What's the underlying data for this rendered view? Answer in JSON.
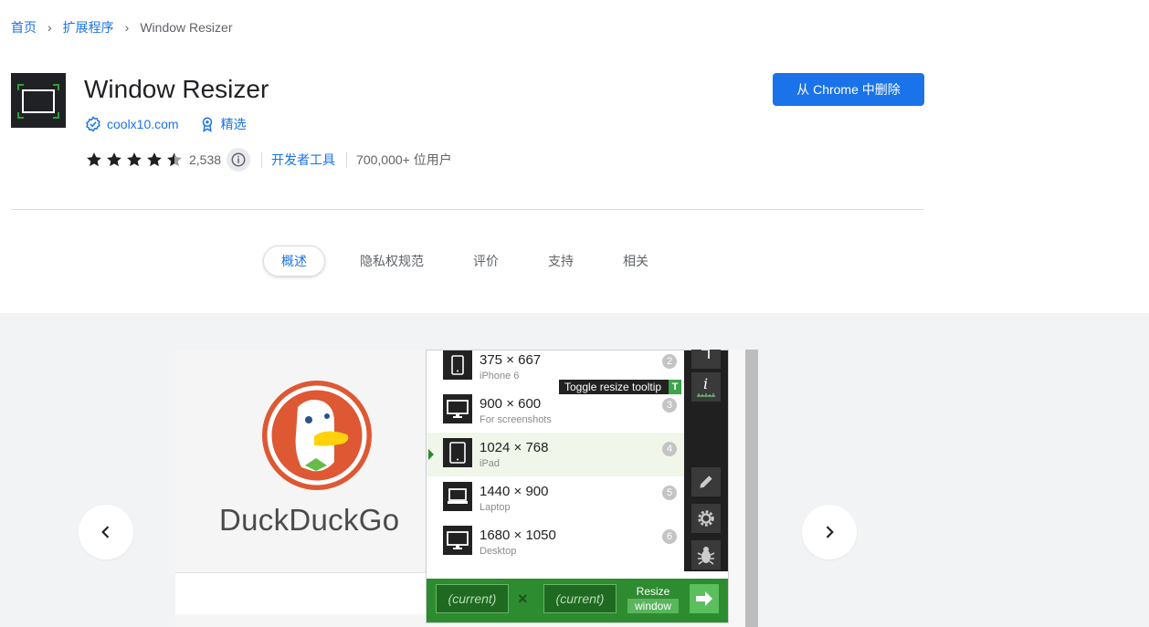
{
  "breadcrumb": {
    "home": "首页",
    "extensions": "扩展程序",
    "current": "Window Resizer"
  },
  "extension": {
    "name": "Window Resizer",
    "developer": "coolx10.com",
    "featured": "精选",
    "rating": 4.5,
    "rating_count": "2,538",
    "category": "开发者工具",
    "users": "700,000+ 位用户",
    "remove_label": "从 Chrome 中删除"
  },
  "tabs": [
    {
      "label": "概述",
      "active": true
    },
    {
      "label": "隐私权规范",
      "active": false
    },
    {
      "label": "评价",
      "active": false
    },
    {
      "label": "支持",
      "active": false
    },
    {
      "label": "相关",
      "active": false
    }
  ],
  "screenshot": {
    "brand": "DuckDuckGo",
    "presets": [
      {
        "resolution": "375 × 667",
        "label": "iPhone 6",
        "num": "2",
        "device": "phone-icon"
      },
      {
        "resolution": "900 × 600",
        "label": "For screenshots",
        "num": "3",
        "device": "monitor-icon"
      },
      {
        "resolution": "1024 × 768",
        "label": "iPad",
        "num": "4",
        "device": "tablet-icon"
      },
      {
        "resolution": "1440 × 900",
        "label": "Laptop",
        "num": "5",
        "device": "laptop-icon"
      },
      {
        "resolution": "1680 × 1050",
        "label": "Desktop",
        "num": "6",
        "device": "monitor-icon"
      }
    ],
    "tooltip": "Toggle resize tooltip",
    "tooltip_key": "T",
    "width_placeholder": "(current)",
    "height_placeholder": "(current)",
    "times": "×",
    "resize_label": "Resize",
    "window_label": "window"
  },
  "colors": {
    "accent": "#1a73e8",
    "resizer_green": "#2d8c2f"
  }
}
